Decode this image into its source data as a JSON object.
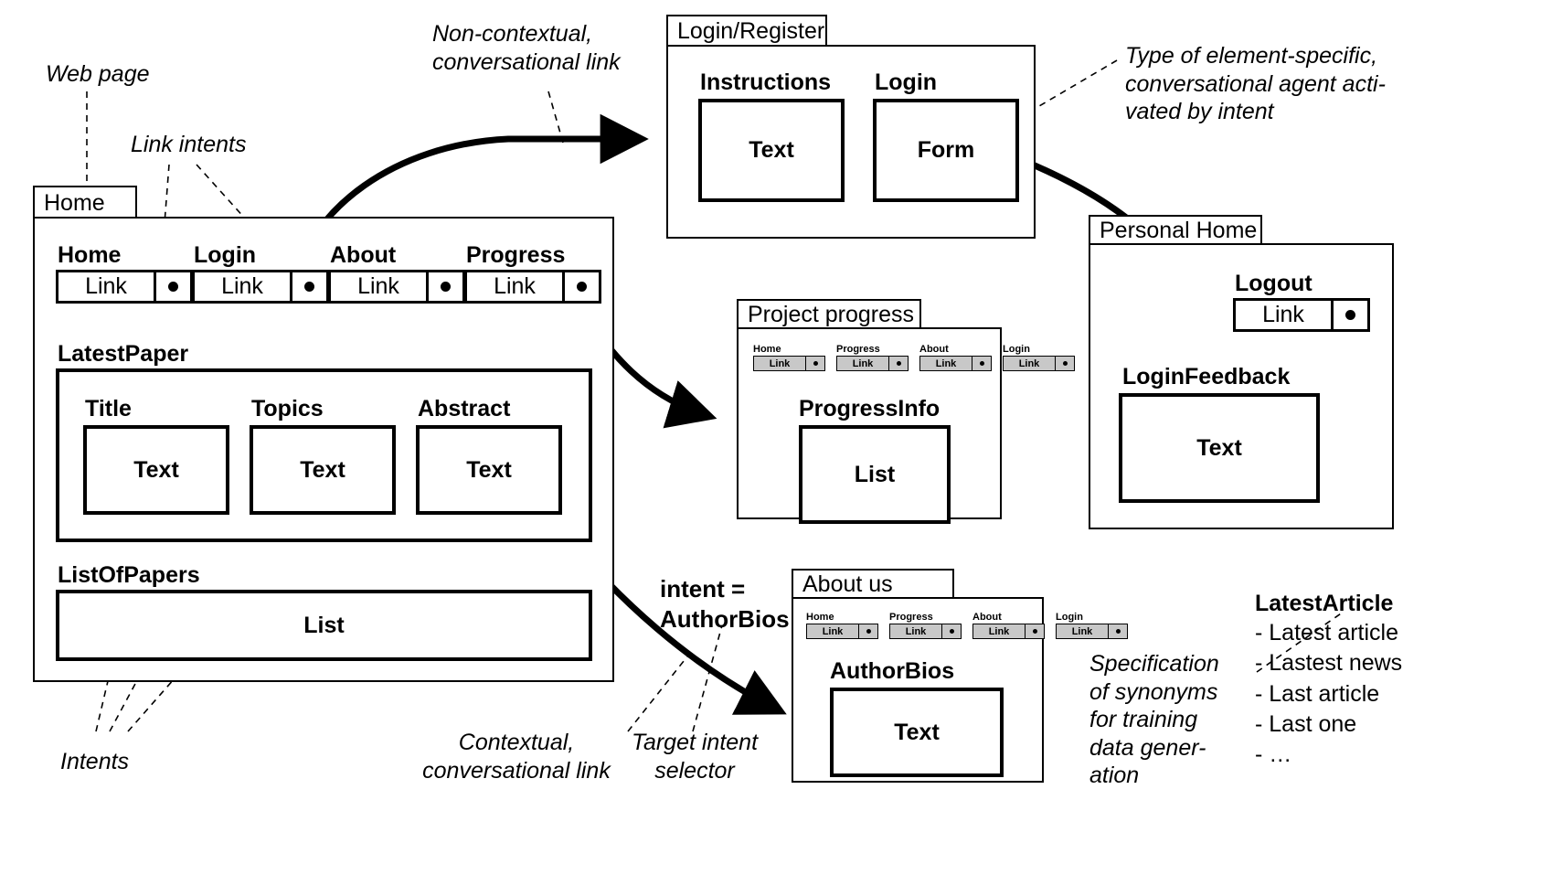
{
  "diagram": {
    "title": "Conversational web page intent annotation diagram"
  },
  "annotations": {
    "web_page": "Web page",
    "link_intents": "Link intents",
    "non_contextual": "Non-contextual,\nconversational link",
    "element_specific": "Type of element-specific,\nconversational agent acti-\nvated by intent",
    "intents": "Intents",
    "contextual": "Contextual,\nconversational link",
    "target_intent_selector": "Target intent\nselector",
    "intent_equals": "intent =\nAuthorBios",
    "synonyms_spec": "Specification\nof synonyms\nfor training\ndata gener-\nation"
  },
  "synonyms": {
    "title": "LatestArticle",
    "items": "- Latest article\n- Lastest news\n- Last article\n- Last one\n- …"
  },
  "home_window": {
    "tab": "Home",
    "nav": [
      {
        "label": "Home",
        "link": "Link"
      },
      {
        "label": "Login",
        "link": "Link"
      },
      {
        "label": "About",
        "link": "Link"
      },
      {
        "label": "Progress",
        "link": "Link"
      }
    ],
    "latest_paper": {
      "label": "LatestPaper",
      "fields": [
        {
          "label": "Title",
          "content": "Text"
        },
        {
          "label": "Topics",
          "content": "Text"
        },
        {
          "label": "Abstract",
          "content": "Text"
        }
      ]
    },
    "list_of_papers": {
      "label": "ListOfPapers",
      "content": "List"
    }
  },
  "login_window": {
    "tab": "Login/Register",
    "sections": [
      {
        "label": "Instructions",
        "content": "Text"
      },
      {
        "label": "Login",
        "content": "Form"
      }
    ]
  },
  "personal_home_window": {
    "tab": "Personal Home",
    "nav": [
      {
        "label": "Logout",
        "link": "Link"
      }
    ],
    "feedback": {
      "label": "LoginFeedback",
      "content": "Text"
    }
  },
  "progress_window": {
    "tab": "Project progress",
    "nav": [
      {
        "label": "Home",
        "link": "Link"
      },
      {
        "label": "Progress",
        "link": "Link"
      },
      {
        "label": "About",
        "link": "Link"
      },
      {
        "label": "Login",
        "link": "Link"
      }
    ],
    "content": {
      "label": "ProgressInfo",
      "content": "List"
    }
  },
  "about_window": {
    "tab": "About us",
    "nav": [
      {
        "label": "Home",
        "link": "Link"
      },
      {
        "label": "Progress",
        "link": "Link"
      },
      {
        "label": "About",
        "link": "Link"
      },
      {
        "label": "Login",
        "link": "Link"
      }
    ],
    "content": {
      "label": "AuthorBios",
      "content": "Text"
    }
  },
  "colors": {
    "stroke": "#000000",
    "background": "#ffffff",
    "mini_fill": "#c8c8c8"
  }
}
